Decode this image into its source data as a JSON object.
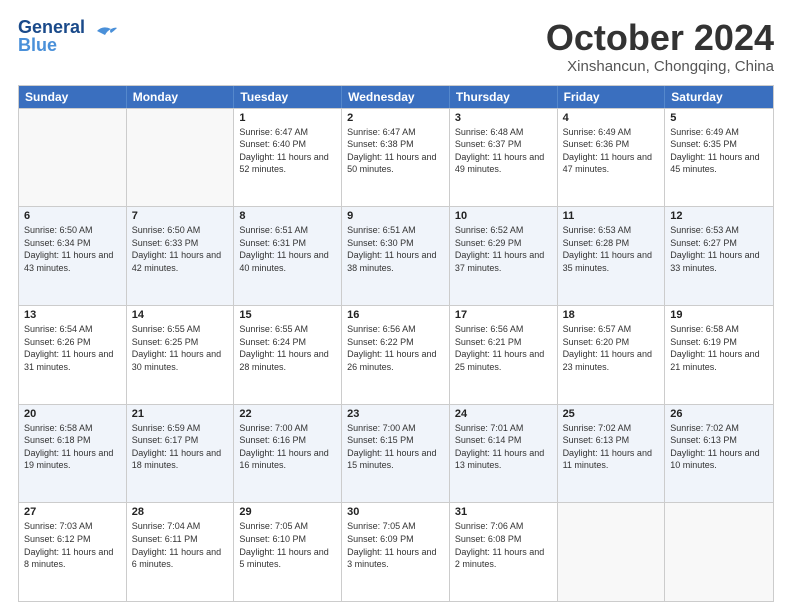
{
  "logo": {
    "line1": "General",
    "line2": "Blue"
  },
  "title": "October 2024",
  "location": "Xinshancun, Chongqing, China",
  "weekdays": [
    "Sunday",
    "Monday",
    "Tuesday",
    "Wednesday",
    "Thursday",
    "Friday",
    "Saturday"
  ],
  "rows": [
    [
      {
        "day": "",
        "text": ""
      },
      {
        "day": "",
        "text": ""
      },
      {
        "day": "1",
        "text": "Sunrise: 6:47 AM\nSunset: 6:40 PM\nDaylight: 11 hours and 52 minutes."
      },
      {
        "day": "2",
        "text": "Sunrise: 6:47 AM\nSunset: 6:38 PM\nDaylight: 11 hours and 50 minutes."
      },
      {
        "day": "3",
        "text": "Sunrise: 6:48 AM\nSunset: 6:37 PM\nDaylight: 11 hours and 49 minutes."
      },
      {
        "day": "4",
        "text": "Sunrise: 6:49 AM\nSunset: 6:36 PM\nDaylight: 11 hours and 47 minutes."
      },
      {
        "day": "5",
        "text": "Sunrise: 6:49 AM\nSunset: 6:35 PM\nDaylight: 11 hours and 45 minutes."
      }
    ],
    [
      {
        "day": "6",
        "text": "Sunrise: 6:50 AM\nSunset: 6:34 PM\nDaylight: 11 hours and 43 minutes."
      },
      {
        "day": "7",
        "text": "Sunrise: 6:50 AM\nSunset: 6:33 PM\nDaylight: 11 hours and 42 minutes."
      },
      {
        "day": "8",
        "text": "Sunrise: 6:51 AM\nSunset: 6:31 PM\nDaylight: 11 hours and 40 minutes."
      },
      {
        "day": "9",
        "text": "Sunrise: 6:51 AM\nSunset: 6:30 PM\nDaylight: 11 hours and 38 minutes."
      },
      {
        "day": "10",
        "text": "Sunrise: 6:52 AM\nSunset: 6:29 PM\nDaylight: 11 hours and 37 minutes."
      },
      {
        "day": "11",
        "text": "Sunrise: 6:53 AM\nSunset: 6:28 PM\nDaylight: 11 hours and 35 minutes."
      },
      {
        "day": "12",
        "text": "Sunrise: 6:53 AM\nSunset: 6:27 PM\nDaylight: 11 hours and 33 minutes."
      }
    ],
    [
      {
        "day": "13",
        "text": "Sunrise: 6:54 AM\nSunset: 6:26 PM\nDaylight: 11 hours and 31 minutes."
      },
      {
        "day": "14",
        "text": "Sunrise: 6:55 AM\nSunset: 6:25 PM\nDaylight: 11 hours and 30 minutes."
      },
      {
        "day": "15",
        "text": "Sunrise: 6:55 AM\nSunset: 6:24 PM\nDaylight: 11 hours and 28 minutes."
      },
      {
        "day": "16",
        "text": "Sunrise: 6:56 AM\nSunset: 6:22 PM\nDaylight: 11 hours and 26 minutes."
      },
      {
        "day": "17",
        "text": "Sunrise: 6:56 AM\nSunset: 6:21 PM\nDaylight: 11 hours and 25 minutes."
      },
      {
        "day": "18",
        "text": "Sunrise: 6:57 AM\nSunset: 6:20 PM\nDaylight: 11 hours and 23 minutes."
      },
      {
        "day": "19",
        "text": "Sunrise: 6:58 AM\nSunset: 6:19 PM\nDaylight: 11 hours and 21 minutes."
      }
    ],
    [
      {
        "day": "20",
        "text": "Sunrise: 6:58 AM\nSunset: 6:18 PM\nDaylight: 11 hours and 19 minutes."
      },
      {
        "day": "21",
        "text": "Sunrise: 6:59 AM\nSunset: 6:17 PM\nDaylight: 11 hours and 18 minutes."
      },
      {
        "day": "22",
        "text": "Sunrise: 7:00 AM\nSunset: 6:16 PM\nDaylight: 11 hours and 16 minutes."
      },
      {
        "day": "23",
        "text": "Sunrise: 7:00 AM\nSunset: 6:15 PM\nDaylight: 11 hours and 15 minutes."
      },
      {
        "day": "24",
        "text": "Sunrise: 7:01 AM\nSunset: 6:14 PM\nDaylight: 11 hours and 13 minutes."
      },
      {
        "day": "25",
        "text": "Sunrise: 7:02 AM\nSunset: 6:13 PM\nDaylight: 11 hours and 11 minutes."
      },
      {
        "day": "26",
        "text": "Sunrise: 7:02 AM\nSunset: 6:13 PM\nDaylight: 11 hours and 10 minutes."
      }
    ],
    [
      {
        "day": "27",
        "text": "Sunrise: 7:03 AM\nSunset: 6:12 PM\nDaylight: 11 hours and 8 minutes."
      },
      {
        "day": "28",
        "text": "Sunrise: 7:04 AM\nSunset: 6:11 PM\nDaylight: 11 hours and 6 minutes."
      },
      {
        "day": "29",
        "text": "Sunrise: 7:05 AM\nSunset: 6:10 PM\nDaylight: 11 hours and 5 minutes."
      },
      {
        "day": "30",
        "text": "Sunrise: 7:05 AM\nSunset: 6:09 PM\nDaylight: 11 hours and 3 minutes."
      },
      {
        "day": "31",
        "text": "Sunrise: 7:06 AM\nSunset: 6:08 PM\nDaylight: 11 hours and 2 minutes."
      },
      {
        "day": "",
        "text": ""
      },
      {
        "day": "",
        "text": ""
      }
    ]
  ]
}
